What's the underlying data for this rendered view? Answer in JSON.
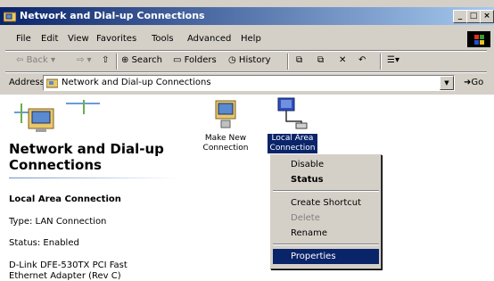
{
  "window": {
    "title": "Network and Dial-up Connections",
    "title_bar_color": "#0a246a",
    "controls": [
      "minimize",
      "maximize",
      "close"
    ]
  },
  "menu": [
    "File",
    "Edit",
    "View",
    "Favorites",
    "Tools",
    "Advanced",
    "Help"
  ],
  "toolbar": {
    "back": "Back",
    "search": "Search",
    "folders": "Folders",
    "history": "History"
  },
  "address": {
    "label": "Address",
    "value": "Network and Dial-up Connections",
    "go": "Go"
  },
  "left_panel": {
    "heading": "Network and Dial-up Connections",
    "selected_name": "Local Area Connection",
    "type": "Type: LAN Connection",
    "status": "Status: Enabled",
    "device_line1": "D-Link DFE-530TX PCI Fast",
    "device_line2": "Ethernet Adapter (Rev C)"
  },
  "icons": [
    {
      "label": "Make New Connection",
      "icon": "make-new-connection-icon"
    },
    {
      "label": "Local Area Connection",
      "icon": "local-area-connection-icon"
    }
  ],
  "context_menu": {
    "items": [
      "Disable",
      "Status",
      "Create Shortcut",
      "Delete",
      "Rename",
      "Properties"
    ],
    "default_item": "Status",
    "disabled_item": "Delete",
    "highlighted_item": "Properties",
    "highlight_color": "#0a246a"
  }
}
